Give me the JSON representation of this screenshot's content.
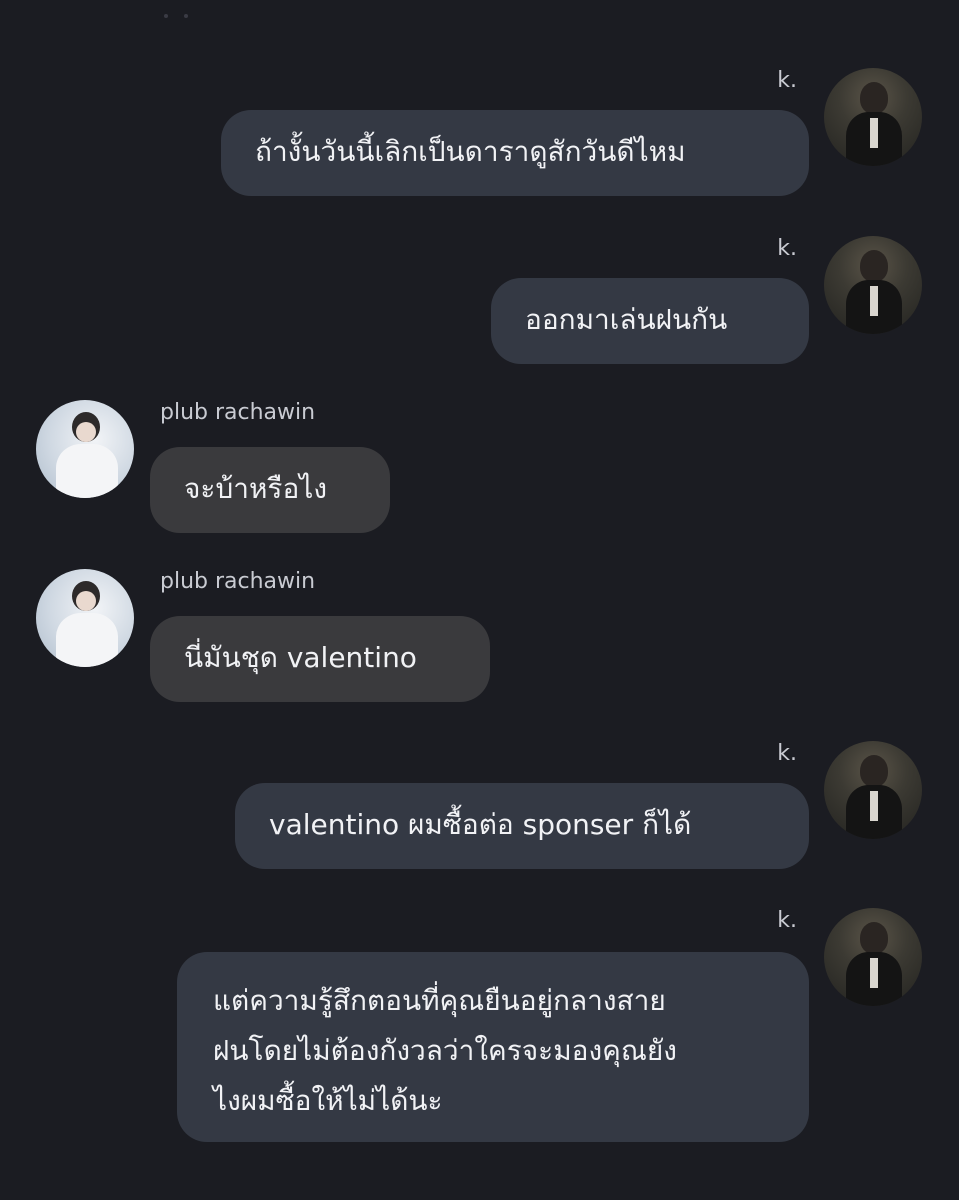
{
  "messages": [
    {
      "sender": "k.",
      "text": "ถ้างั้นวันนี้เลิกเป็นดาราดูสักวันดีไหม"
    },
    {
      "sender": "k.",
      "text": "ออกมาเล่นฝนกัน"
    },
    {
      "sender": "plub rachawin",
      "text": "จะบ้าหรือไง"
    },
    {
      "sender": "plub rachawin",
      "text": "นี่มันชุด valentino"
    },
    {
      "sender": "k.",
      "text": "valentino ผมซื้อต่อ sponser ก็ได้"
    },
    {
      "sender": "k.",
      "lines": [
        "แต่ความรู้สึกตอนที่คุณยืนอยู่กลางสาย",
        "ฝนโดยไม่ต้องกังวลว่าใครจะมองคุณยัง",
        "ไงผมซื้อให้ไม่ได้นะ"
      ]
    }
  ],
  "colors": {
    "background": "#1b1c22",
    "outgoing_bubble": "#343944",
    "incoming_bubble": "#3a3a3d",
    "text": "#f1f2f5",
    "name": "#c9cbd2"
  }
}
